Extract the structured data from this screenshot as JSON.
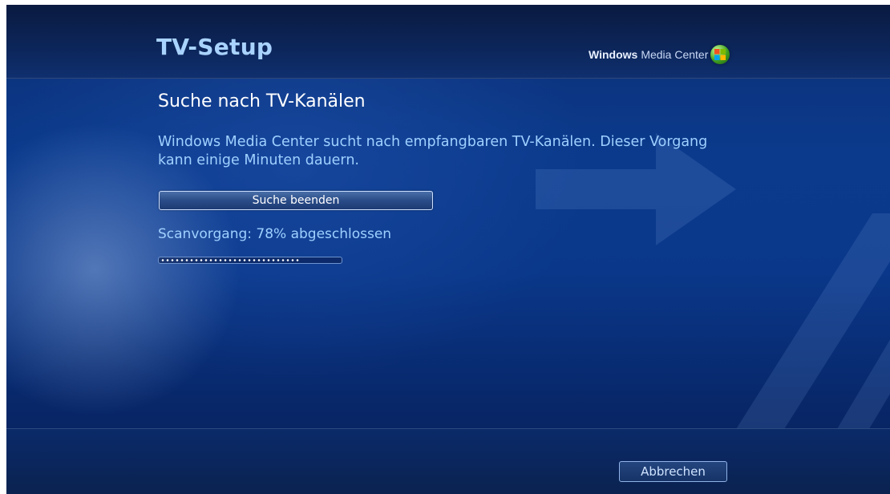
{
  "header": {
    "title": "TV-Setup",
    "brand_bold": "Windows",
    "brand_rest": "Media Center"
  },
  "main": {
    "heading": "Suche nach TV-Kanälen",
    "description": "Windows Media Center sucht nach empfangbaren TV-Kanälen. Dieser Vorgang kann einige Minuten dauern.",
    "stop_button_label": "Suche beenden",
    "status_text": "Scanvorgang: 78% abgeschlossen",
    "progress_fraction": 0.78
  },
  "footer": {
    "cancel_button_label": "Abbrechen"
  },
  "colors": {
    "background": "#0b3a8c",
    "title_text": "#a9d3ff",
    "body_text": "#9fd0ff"
  },
  "icons": {
    "brand_logo": "windows-logo-icon"
  }
}
